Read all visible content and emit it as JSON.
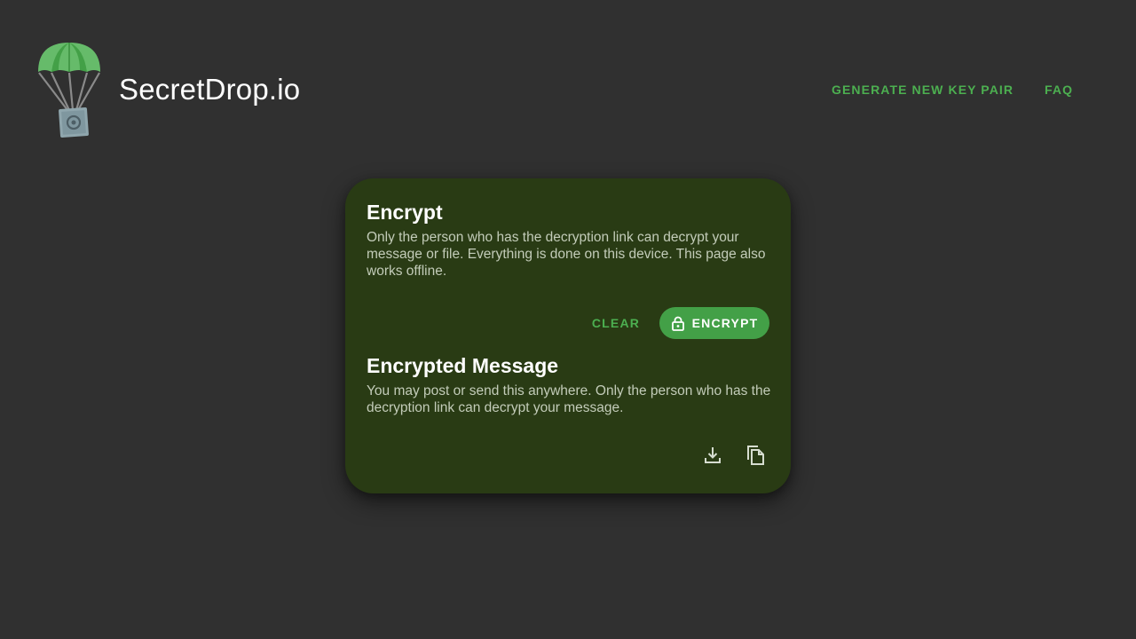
{
  "header": {
    "brand": "SecretDrop.io",
    "nav": {
      "generate_key_pair": "GENERATE NEW KEY PAIR",
      "faq": "FAQ"
    },
    "logo_icon": "parachute-safe-icon"
  },
  "encrypt_section": {
    "title": "Encrypt",
    "description": "Only the person who has the decryption link can decrypt your message or file. Everything is done on this device. This page also works offline.",
    "clear_label": "CLEAR",
    "encrypt_label": "ENCRYPT",
    "encrypt_icon": "lock-icon"
  },
  "encrypted_section": {
    "title": "Encrypted Message",
    "description": "You may post or send this anywhere. Only the person who has the decryption link can decrypt your message.",
    "download_icon": "download-icon",
    "copy_icon": "copy-icon"
  },
  "colors": {
    "background": "#303030",
    "card": "#293b14",
    "accent": "#4caf50",
    "button": "#43a047"
  }
}
